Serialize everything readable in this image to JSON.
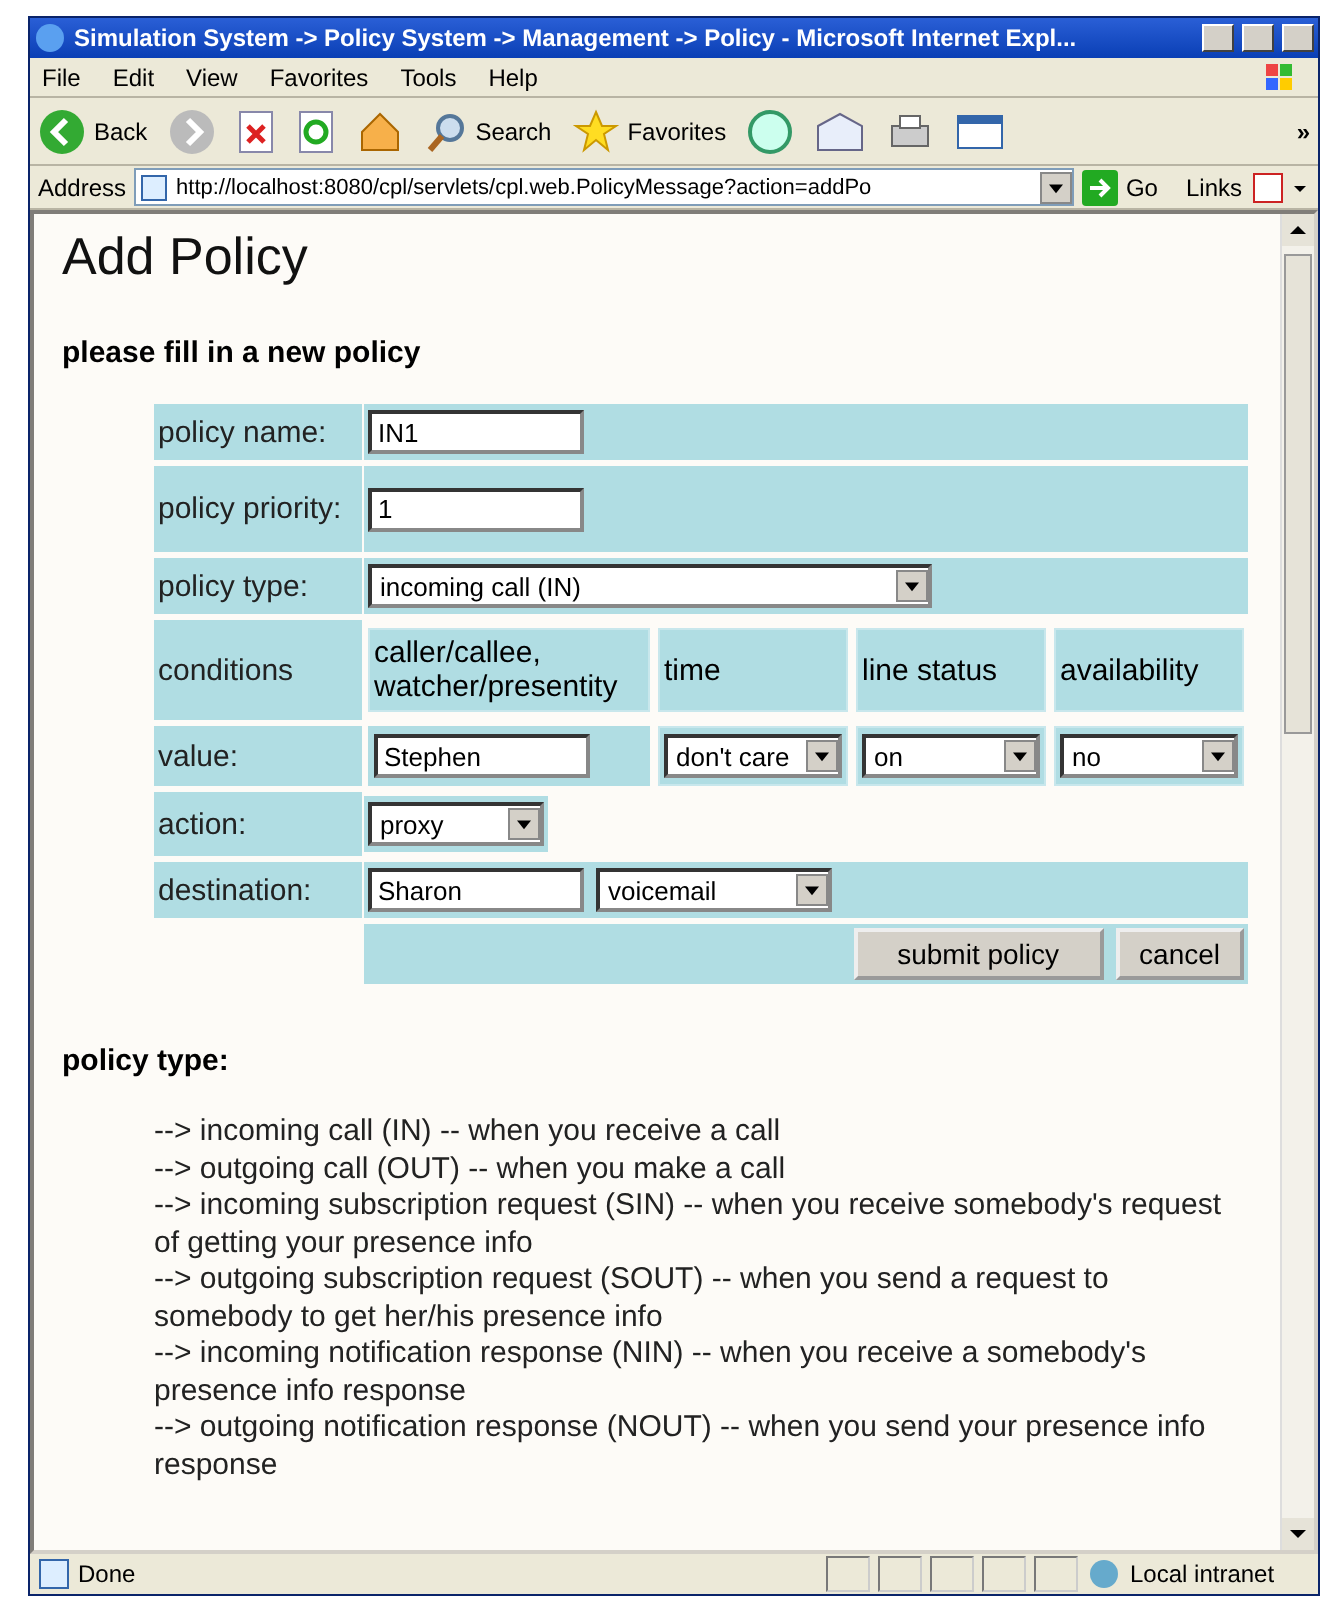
{
  "window": {
    "title": "Simulation System -> Policy System -> Management -> Policy - Microsoft Internet Expl..."
  },
  "menu": [
    "File",
    "Edit",
    "View",
    "Favorites",
    "Tools",
    "Help"
  ],
  "toolbar": {
    "back": "Back",
    "search": "Search",
    "favorites": "Favorites",
    "more": "»"
  },
  "address": {
    "label": "Address",
    "url": "http://localhost:8080/cpl/servlets/cpl.web.PolicyMessage?action=addPo",
    "go": "Go",
    "links": "Links"
  },
  "page": {
    "heading": "Add Policy",
    "subheading": "please fill in a new policy",
    "form": {
      "name": {
        "label": "policy name:",
        "value": "IN1"
      },
      "priority": {
        "label": "policy priority:",
        "value": "1"
      },
      "type": {
        "label": "policy type:",
        "value": "incoming call (IN)"
      },
      "conditions": {
        "label": "conditions",
        "headers": [
          "caller/callee, watcher/presentity",
          "time",
          "line status",
          "availability"
        ]
      },
      "values": {
        "label": "value:",
        "caller": "Stephen",
        "time": "don't care",
        "line_status": "on",
        "availability": "no"
      },
      "action": {
        "label": "action:",
        "value": "proxy"
      },
      "destination": {
        "label": "destination:",
        "name": "Sharon",
        "option": "voicemail"
      },
      "buttons": [
        "submit policy",
        "cancel"
      ]
    },
    "section": "policy type:",
    "descriptions": [
      "--> incoming call (IN) -- when you receive a call",
      "--> outgoing call (OUT) -- when you make a call",
      "--> incoming subscription request (SIN) -- when you receive somebody's request of getting your presence info",
      "--> outgoing subscription request (SOUT) -- when you send a request to somebody to get her/his presence info",
      "--> incoming notification response (NIN) -- when you receive a somebody's presence info response",
      "--> outgoing notification response (NOUT) -- when you send your presence info response"
    ]
  },
  "status_bar": {
    "text": "Done",
    "zone": "Local intranet"
  }
}
